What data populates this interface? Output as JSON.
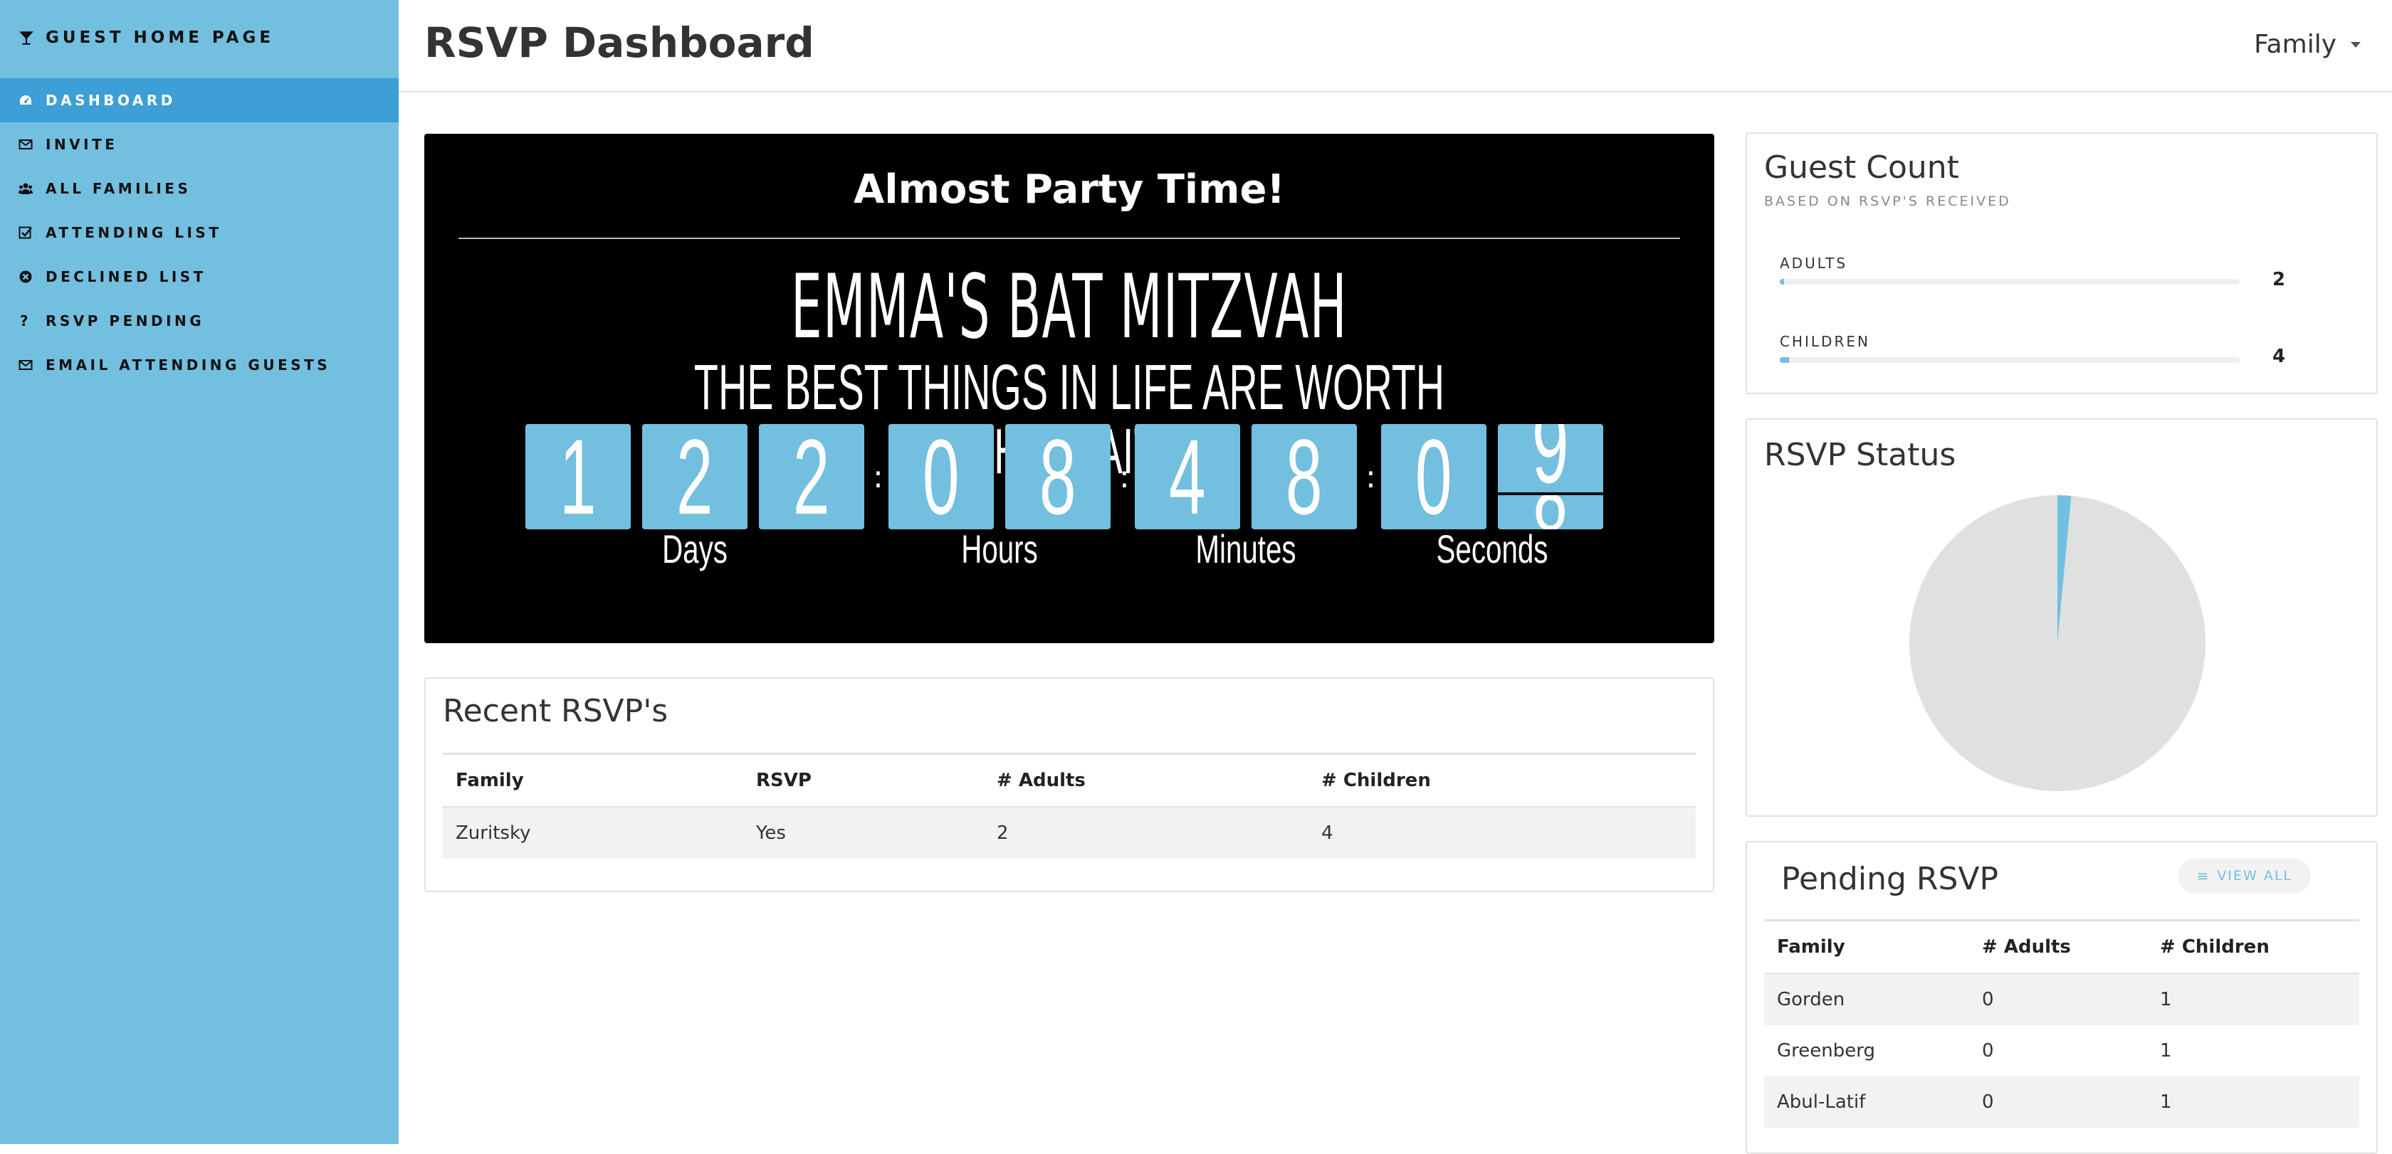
{
  "sidebar": {
    "brand": "Guest Home Page",
    "items": [
      {
        "label": "Dashboard",
        "icon": "dashboard-icon",
        "active": true
      },
      {
        "label": "Invite",
        "icon": "envelope-icon"
      },
      {
        "label": "All Families",
        "icon": "users-icon"
      },
      {
        "label": "Attending List",
        "icon": "check-square-icon"
      },
      {
        "label": "Declined List",
        "icon": "times-circle-icon"
      },
      {
        "label": "RSVP Pending",
        "icon": "question-icon"
      },
      {
        "label": "Email Attending Guests",
        "icon": "envelope-icon"
      }
    ]
  },
  "header": {
    "title": "RSVP Dashboard",
    "user_menu": "Family"
  },
  "countdown": {
    "heading": "Almost Party Time!",
    "event_title": "EMMA'S BAT MITZVAH",
    "subtitle": "THE BEST THINGS IN LIFE ARE WORTH THE WAIT!",
    "digits": {
      "days": [
        "1",
        "2",
        "2"
      ],
      "hours": [
        "0",
        "8"
      ],
      "minutes": [
        "4",
        "8"
      ],
      "seconds": [
        "0",
        "9"
      ]
    },
    "seconds_next_digit": "8",
    "labels": {
      "days": "Days",
      "hours": "Hours",
      "minutes": "Minutes",
      "seconds": "Seconds"
    },
    "separator": ":"
  },
  "recent_rsvps": {
    "title": "Recent RSVP's",
    "columns": [
      "Family",
      "RSVP",
      "# Adults",
      "# Children"
    ],
    "rows": [
      [
        "Zuritsky",
        "Yes",
        "2",
        "4"
      ]
    ]
  },
  "guest_count": {
    "title": "Guest Count",
    "subtitle": "Based on RSVP's received",
    "rows": [
      {
        "label": "Adults",
        "value": "2",
        "fill_fraction": 0.01
      },
      {
        "label": "Children",
        "value": "4",
        "fill_fraction": 0.02
      }
    ]
  },
  "rsvp_status": {
    "title": "RSVP Status",
    "chart_data": {
      "type": "pie",
      "slices": [
        {
          "value": 0.015,
          "color": "#73bfe0"
        },
        {
          "value": 0.985,
          "color": "#e0e0e0"
        }
      ]
    }
  },
  "pending_rsvp": {
    "title": "Pending RSVP",
    "view_all_label": "View All",
    "columns": [
      "Family",
      "# Adults",
      "# Children"
    ],
    "rows": [
      [
        "Gorden",
        "0",
        "1"
      ],
      [
        "Greenberg",
        "0",
        "1"
      ],
      [
        "Abul-Latif",
        "0",
        "1"
      ]
    ]
  },
  "colors": {
    "accent": "#73bfe0",
    "active": "#3d9fd5",
    "countdown_bg": "#000000"
  }
}
